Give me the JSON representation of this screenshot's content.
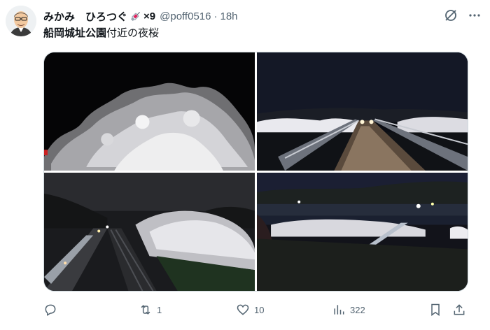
{
  "tweet": {
    "author": {
      "display_name": "みかみ　ひろつぐ",
      "badge_icon": "syringe-emoji",
      "badge_count": "×9",
      "handle": "@poff0516",
      "separator": "·",
      "time": "18h"
    },
    "text_highlight": "船岡城址公園",
    "text_rest": "付近の夜桜",
    "media": [
      {
        "subject": "sakura-tree-night"
      },
      {
        "subject": "illuminated-bridge"
      },
      {
        "subject": "sakura-road-night"
      },
      {
        "subject": "sakura-river-night"
      }
    ],
    "actions": {
      "reply": {
        "icon": "reply-icon",
        "count": ""
      },
      "retweet": {
        "icon": "retweet-icon",
        "count": "1"
      },
      "like": {
        "icon": "heart-icon",
        "count": "10"
      },
      "views": {
        "icon": "views-icon",
        "count": "322"
      },
      "bookmark": {
        "icon": "bookmark-icon"
      },
      "share": {
        "icon": "share-icon"
      }
    }
  },
  "colors": {
    "text": "#0f1419",
    "muted": "#536471",
    "border": "#cfd9de"
  }
}
